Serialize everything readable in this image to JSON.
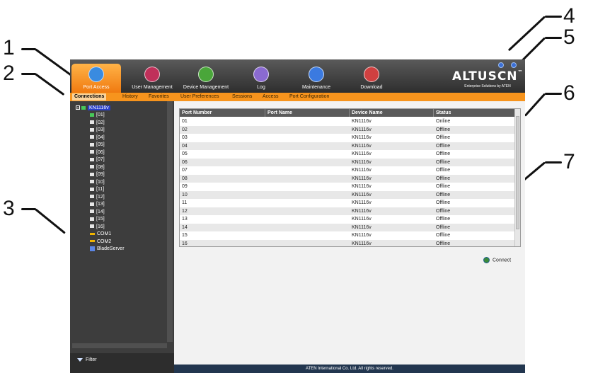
{
  "callouts": [
    "1",
    "2",
    "3",
    "4",
    "5",
    "6",
    "7"
  ],
  "nav": {
    "tabs": [
      {
        "label": "Port Access",
        "icon": "port-access-icon",
        "color": "#3a8be0"
      },
      {
        "label": "User Management",
        "icon": "user-management-icon",
        "color": "#c0305a"
      },
      {
        "label": "Device Management",
        "icon": "device-management-icon",
        "color": "#4aa63a"
      },
      {
        "label": "Log",
        "icon": "log-icon",
        "color": "#8a6ad0"
      },
      {
        "label": "Maintenance",
        "icon": "maintenance-icon",
        "color": "#3b7ae0"
      },
      {
        "label": "Download",
        "icon": "download-icon",
        "color": "#d04040"
      }
    ],
    "active_tab": "Port Access"
  },
  "brand": {
    "name": "ALTUSCN",
    "tm": "™",
    "tagline": "Enterprise Solutions by ATEN"
  },
  "subnav": {
    "tabs": [
      "Connections",
      "History",
      "Favorites",
      "User Preferences",
      "Sessions",
      "Access",
      "Port Configuration"
    ],
    "active_tab": "Connections"
  },
  "sidebar": {
    "root": "KN1116v",
    "ports": [
      "[01]",
      "[02]",
      "[03]",
      "[04]",
      "[05]",
      "[06]",
      "[07]",
      "[08]",
      "[09]",
      "[10]",
      "[11]",
      "[12]",
      "[13]",
      "[14]",
      "[15]",
      "[16]"
    ],
    "extras": [
      "COM1",
      "COM2",
      "BladeServer"
    ],
    "filter_label": "Filter"
  },
  "table": {
    "columns": [
      "Port Number",
      "Port Name",
      "Device Name",
      "Status"
    ],
    "rows": [
      {
        "port_number": "01",
        "port_name": "",
        "device_name": "KN1116v",
        "status": "Online"
      },
      {
        "port_number": "02",
        "port_name": "",
        "device_name": "KN1116v",
        "status": "Offline"
      },
      {
        "port_number": "03",
        "port_name": "",
        "device_name": "KN1116v",
        "status": "Offline"
      },
      {
        "port_number": "04",
        "port_name": "",
        "device_name": "KN1116v",
        "status": "Offline"
      },
      {
        "port_number": "05",
        "port_name": "",
        "device_name": "KN1116v",
        "status": "Offline"
      },
      {
        "port_number": "06",
        "port_name": "",
        "device_name": "KN1116v",
        "status": "Offline"
      },
      {
        "port_number": "07",
        "port_name": "",
        "device_name": "KN1116v",
        "status": "Offline"
      },
      {
        "port_number": "08",
        "port_name": "",
        "device_name": "KN1116v",
        "status": "Offline"
      },
      {
        "port_number": "09",
        "port_name": "",
        "device_name": "KN1116v",
        "status": "Offline"
      },
      {
        "port_number": "10",
        "port_name": "",
        "device_name": "KN1116v",
        "status": "Offline"
      },
      {
        "port_number": "11",
        "port_name": "",
        "device_name": "KN1116v",
        "status": "Offline"
      },
      {
        "port_number": "12",
        "port_name": "",
        "device_name": "KN1116v",
        "status": "Offline"
      },
      {
        "port_number": "13",
        "port_name": "",
        "device_name": "KN1116v",
        "status": "Offline"
      },
      {
        "port_number": "14",
        "port_name": "",
        "device_name": "KN1116v",
        "status": "Offline"
      },
      {
        "port_number": "15",
        "port_name": "",
        "device_name": "KN1116v",
        "status": "Offline"
      },
      {
        "port_number": "16",
        "port_name": "",
        "device_name": "KN1116v",
        "status": "Offline"
      }
    ]
  },
  "actions": {
    "connect_label": "Connect"
  },
  "footer": {
    "text": "ATEN International Co. Ltd. All rights reserved."
  },
  "colors": {
    "accent_orange": "#f7941d",
    "footer_blue": "#22364f",
    "selection_blue": "#2a40c8"
  }
}
